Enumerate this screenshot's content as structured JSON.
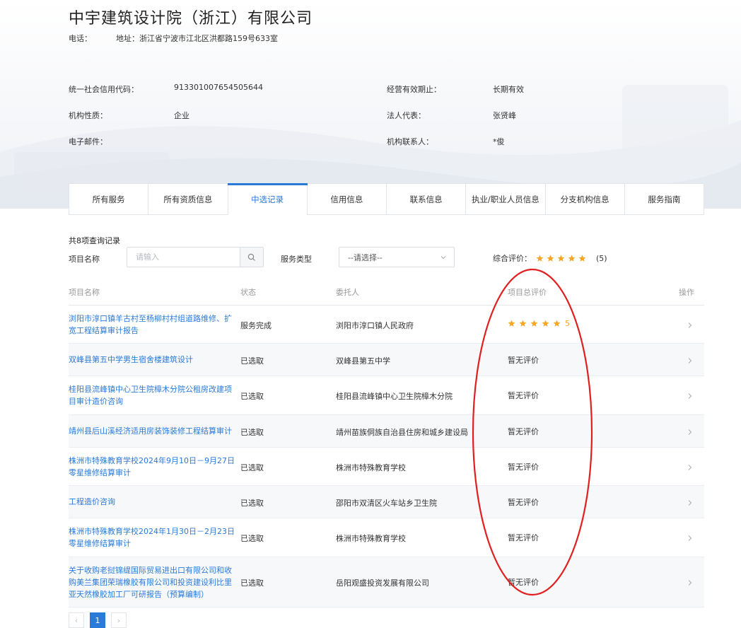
{
  "company": {
    "name": "中宇建筑设计院（浙江）有限公司",
    "phone_label": "电话：",
    "phone_value": "",
    "address_label": "地址：",
    "address_value": "浙江省宁波市江北区洪都路159号633室"
  },
  "info": {
    "credit_code_label": "统一社会信用代码：",
    "credit_code_value": "913301007654505644",
    "valid_label": "经营有效期止：",
    "valid_value": "长期有效",
    "org_type_label": "机构性质：",
    "org_type_value": "企业",
    "legal_rep_label": "法人代表：",
    "legal_rep_value": "张贤峰",
    "email_label": "电子邮件：",
    "email_value": "",
    "contact_label": "机构联系人：",
    "contact_value": "*俊"
  },
  "tabs": [
    {
      "label": "所有服务"
    },
    {
      "label": "所有资质信息"
    },
    {
      "label": "中选记录",
      "active": true
    },
    {
      "label": "信用信息"
    },
    {
      "label": "联系信息"
    },
    {
      "label": "执业/职业人员信息"
    },
    {
      "label": "分支机构信息"
    },
    {
      "label": "服务指南"
    }
  ],
  "filters": {
    "count_text": "共8项查询记录",
    "project_label": "项目名称",
    "project_placeholder": "请输入",
    "service_type_label": "服务类型",
    "service_type_value": "--请选择--",
    "overall_label": "综合评价：",
    "overall_stars": 5,
    "overall_count": "(5)"
  },
  "table": {
    "headers": {
      "name": "项目名称",
      "status": "状态",
      "client": "委托人",
      "eval": "项目总评价",
      "op": "操作"
    },
    "rows": [
      {
        "name": "浏阳市淳口镇羊古村至杨柳村村组道路维修、扩宽工程结算审计报告",
        "status": "服务完成",
        "client": "浏阳市淳口镇人民政府",
        "eval_text": "",
        "stars": 5,
        "score": "5"
      },
      {
        "name": "双峰县第五中学男生宿舍楼建筑设计",
        "status": "已选取",
        "client": "双峰县第五中学",
        "eval_text": "暂无评价",
        "stars": 0,
        "score": ""
      },
      {
        "name": "桂阳县流峰镇中心卫生院樟木分院公租房改建项目审计造价咨询",
        "status": "已选取",
        "client": "桂阳县流峰镇中心卫生院樟木分院",
        "eval_text": "暂无评价",
        "stars": 0,
        "score": ""
      },
      {
        "name": "靖州县后山溪经济适用房装饰装修工程结算审计",
        "status": "已选取",
        "client": "靖州苗族侗族自治县住房和城乡建设局",
        "eval_text": "暂无评价",
        "stars": 0,
        "score": ""
      },
      {
        "name": "株洲市特殊教育学校2024年9月10日－9月27日零星维修结算审计",
        "status": "已选取",
        "client": "株洲市特殊教育学校",
        "eval_text": "暂无评价",
        "stars": 0,
        "score": ""
      },
      {
        "name": "工程造价咨询",
        "status": "已选取",
        "client": "邵阳市双清区火车站乡卫生院",
        "eval_text": "暂无评价",
        "stars": 0,
        "score": ""
      },
      {
        "name": "株洲市特殊教育学校2024年1月30日－2月23日零星维修结算审计",
        "status": "已选取",
        "client": "株洲市特殊教育学校",
        "eval_text": "暂无评价",
        "stars": 0,
        "score": ""
      },
      {
        "name": "关于收购老挝锦缇国际贸易进出口有限公司和收购美兰集团荣瑞橡胶有限公司和投资建设利比里亚天然橡胶加工厂可研报告（预算编制）",
        "status": "已选取",
        "client": "岳阳观盛投资发展有限公司",
        "eval_text": "暂无评价",
        "stars": 0,
        "score": ""
      }
    ]
  },
  "pager": {
    "prev": "‹",
    "current": "1",
    "next": "›"
  },
  "colors": {
    "accent": "#2a7ad9",
    "star": "#f5a623",
    "annotation": "#e02020"
  },
  "icons": {
    "search": "search-icon",
    "select": "chevron-down-icon",
    "row_op": "chevron-right-icon",
    "star": "star-icon"
  }
}
